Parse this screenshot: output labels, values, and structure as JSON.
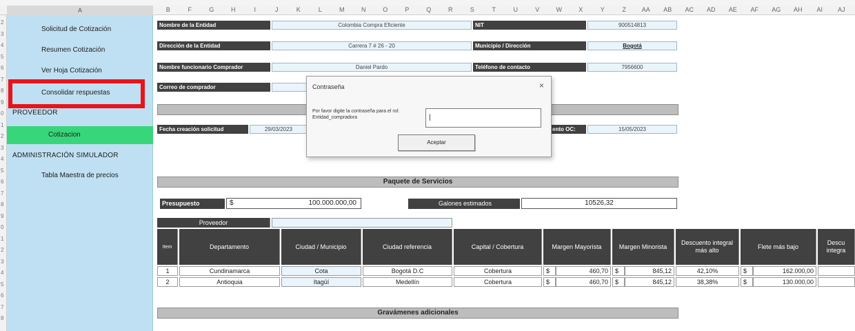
{
  "column_headers": [
    "A",
    "B",
    "F",
    "G",
    "H",
    "I",
    "J",
    "K",
    "L",
    "M",
    "N",
    "O",
    "P",
    "Q",
    "R",
    "S",
    "T",
    "U",
    "V",
    "W",
    "X",
    "Y",
    "Z",
    "AA",
    "AB",
    "AC",
    "AD",
    "AE",
    "AF",
    "AG",
    "AH",
    "AI",
    "AJ"
  ],
  "row_numbers": [
    "2",
    "3",
    "4",
    "5",
    "6",
    "7",
    "8",
    "9",
    "0",
    "1",
    "2",
    "3",
    "4",
    "5",
    "6",
    "7",
    "8",
    "9",
    "0",
    "1",
    "2",
    "3",
    "4",
    "5",
    "6",
    "7",
    "8"
  ],
  "sidebar": {
    "items": [
      {
        "label": "Solicitud de Cotización"
      },
      {
        "label": "Resumen Cotización"
      },
      {
        "label": "Ver Hoja Cotización"
      },
      {
        "label": "Consolidar respuestas"
      }
    ],
    "section_proveedor": "PROVEEDOR",
    "cotizacion": "Cotizacion",
    "section_admin": "ADMINISTRACIÓN SIMULADOR",
    "tabla_maestra": "Tabla Maestra de precios"
  },
  "form": {
    "nombre_entidad_label": "Nombre de la Entidad",
    "nombre_entidad_value": "Colombia Compra Eficiente",
    "nit_label": "NIT",
    "nit_value": "900514813",
    "direccion_label": "Dirección de la Entidad",
    "direccion_value": "Carrera 7 # 26 - 20",
    "municipio_label": "Municipio / Dirección",
    "municipio_value": "Bogotá",
    "funcionario_label": "Nombre funcionario Comprador",
    "funcionario_value": "Daniel Pardo",
    "telefono_label": "Teléfono de contacto",
    "telefono_value": "7956600",
    "correo_label": "Correo de comprador",
    "fecha_label": "Fecha creación solicitud",
    "fecha_value": "29/03/2023",
    "oc_label": "ento OC:",
    "oc_value": "15/05/2023"
  },
  "paquete_servicios": "Paquete de Servicios",
  "budget": {
    "presupuesto_label": "Presupuesto",
    "currency": "$",
    "presupuesto_value": "100.000.000,00",
    "galones_label": "Galones estimados",
    "galones_value": "10526,32"
  },
  "table": {
    "proveedor_label": "Proveedor",
    "headers": [
      "Item",
      "Departamento",
      "Ciudad / Municipio",
      "Ciudad referencia",
      "Capital / Cobertura",
      "Margen Mayorista",
      "Margen Minorista",
      "Descuento integral más alto",
      "Flete más bajo",
      "Descu integra"
    ],
    "rows": [
      {
        "item": "1",
        "departamento": "Cundinamarca",
        "ciudad": "Cota",
        "referencia": "Bogotá D.C",
        "cobertura": "Cobertura",
        "may_cur": "$",
        "mayorista": "460,70",
        "min_cur": "$",
        "minorista": "845,12",
        "descuento": "42,10%",
        "flete_cur": "$",
        "flete": "162.000,00"
      },
      {
        "item": "2",
        "departamento": "Antioquia",
        "ciudad": "Itagüí",
        "referencia": "Medellín",
        "cobertura": "Cobertura",
        "may_cur": "$",
        "mayorista": "460,70",
        "min_cur": "$",
        "minorista": "845,12",
        "descuento": "38,38%",
        "flete_cur": "$",
        "flete": "130.000,00"
      }
    ]
  },
  "gravamenes": "Gravámenes adicionales",
  "dialog": {
    "title": "Contraseña",
    "close": "×",
    "prompt": "Por favor digite la contraseña para el rol: Entidad_compradora",
    "input_value": "",
    "accept_label": "Aceptar"
  }
}
